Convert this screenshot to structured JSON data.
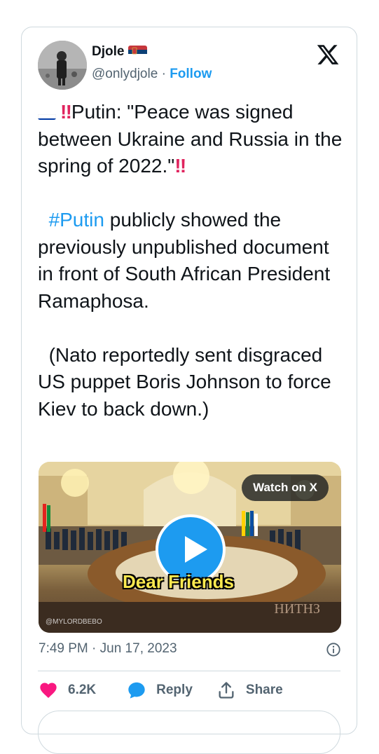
{
  "tweet": {
    "display_name": "Djole",
    "handle": "@onlydjole",
    "separator": "·",
    "follow_label": "Follow",
    "text_line1": "Putin: \"Peace was signed between Ukraine and Russia in the spring of 2022.\"",
    "hashtag": "#Putin",
    "text_line2": " publicly showed the previously unpublished document in front of South African President Ramaphosa.",
    "text_line3": "(Nato reportedly sent disgraced US puppet Boris Johnson to force Kiev to back down.)",
    "media": {
      "watch_label": "Watch on X",
      "caption": "Dear Friends",
      "watermark_left": "@MYLORDBEBO",
      "watermark_right": "НИТНЗ"
    },
    "timestamp": "7:49 PM · Jun 17, 2023",
    "likes": "6.2K",
    "reply_label": "Reply",
    "share_label": "Share"
  },
  "icons": {
    "logo": "x-logo-icon",
    "info": "info-icon",
    "like": "heart-icon",
    "reply": "reply-bubble-icon",
    "share": "share-icon"
  },
  "colors": {
    "accent": "#1d9bf0",
    "like": "#f91880",
    "muted": "#536471",
    "text": "#0f1419"
  }
}
